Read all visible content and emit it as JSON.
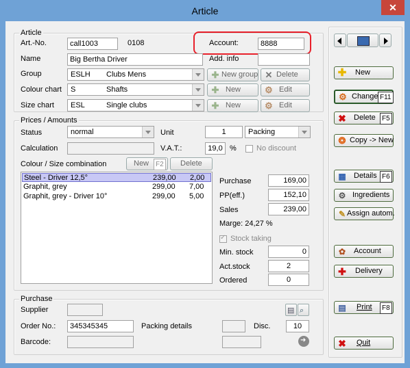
{
  "window": {
    "title": "Article",
    "close": "✕"
  },
  "article": {
    "group_title": "Article",
    "art_no_label": "Art.-No.",
    "art_no": "call1003",
    "art_no_suffix": "0108",
    "account_label": "Account:",
    "account": "8888",
    "name_label": "Name",
    "name": "Big Bertha Driver",
    "add_info_label": "Add. info",
    "group_label": "Group",
    "group_code": "ESLH",
    "group_name": "Clubs Mens",
    "colour_label": "Colour chart",
    "colour_code": "S",
    "colour_name": "Shafts",
    "size_label": "Size chart",
    "size_code": "ESL",
    "size_name": "Single clubs",
    "new_group_btn": "New group",
    "delete_btn": "Delete",
    "new_btn": "New",
    "edit_btn": "Edit"
  },
  "prices": {
    "group_title": "Prices / Amounts",
    "status_label": "Status",
    "status_value": "normal",
    "unit_label": "Unit",
    "unit_value": "1",
    "packing_value": "Packing",
    "calculation_label": "Calculation",
    "vat_label": "V.A.T.:",
    "vat_value": "19,0",
    "percent": "%",
    "no_discount_label": "No discount",
    "combo_label": "Colour / Size combination",
    "combo_new": "New",
    "combo_new_key": "F2",
    "combo_delete": "Delete",
    "rows": [
      {
        "name": "Steel - Driver 12,5°",
        "price": "239,00",
        "qty": "2,00"
      },
      {
        "name": "Graphit, grey",
        "price": "299,00",
        "qty": "7,00"
      },
      {
        "name": "Graphit, grey - Driver 10°",
        "price": "299,00",
        "qty": "5,00"
      }
    ],
    "purchase_label": "Purchase",
    "purchase_value": "169,00",
    "pp_label": "PP(eff.)",
    "pp_value": "152,10",
    "sales_label": "Sales",
    "sales_value": "239,00",
    "marge_label": "Marge: 24,27 %",
    "stock_taking_label": "Stock taking",
    "min_stock_label": "Min. stock",
    "min_stock_value": "0",
    "act_stock_label": "Act.stock",
    "act_stock_value": "2",
    "ordered_label": "Ordered",
    "ordered_value": "0"
  },
  "purchase": {
    "group_title": "Purchase",
    "supplier_label": "Supplier",
    "order_no_label": "Order No.:",
    "order_no_value": "345345345",
    "packing_details_label": "Packing details",
    "disc_label": "Disc.",
    "disc_value": "10",
    "barcode_label": "Barcode:"
  },
  "side": {
    "new": "New",
    "change": "Change",
    "change_key": "F11",
    "delete": "Delete",
    "delete_key": "F5",
    "copy_new": "Copy -> New",
    "details": "Details",
    "details_key": "F6",
    "ingredients": "Ingredients",
    "assign": "Assign autom.",
    "account": "Account",
    "delivery": "Delivery",
    "print": "Print",
    "print_key": "F8",
    "quit": "Quit"
  }
}
